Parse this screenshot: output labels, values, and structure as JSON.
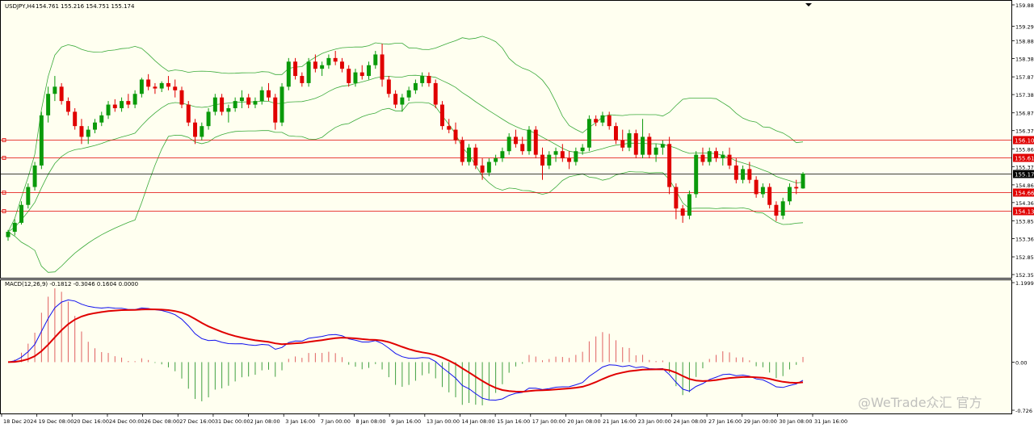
{
  "colors": {
    "background": "#fffff0",
    "frame": "#000000",
    "bull_candle": "#0a9a0a",
    "bear_candle": "#e00000",
    "bollinger": "#3aaa3a",
    "level_line": "#e00000",
    "current_price_line": "#000000",
    "macd_line": "#1010ee",
    "signal_line": "#e00000",
    "hist_positive": "#e06060",
    "hist_negative": "#40a040"
  },
  "chart": {
    "symbol_label": "USDJPY,H4",
    "ohlc_label": "154.761 155.216 154.751 155.174",
    "current_price": 155.174,
    "current_price_label": "155.174",
    "price_range": [
      152.355,
      159.885
    ],
    "price_ticks": [
      "159.885",
      "159.290",
      "158.880",
      "158.385",
      "157.875",
      "157.380",
      "156.870",
      "156.375",
      "155.865",
      "155.370",
      "154.860",
      "154.365",
      "153.855",
      "153.360",
      "152.850",
      "152.355"
    ],
    "levels": [
      {
        "value": 156.109,
        "label": "156.109"
      },
      {
        "value": 155.613,
        "label": "155.613"
      },
      {
        "value": 154.662,
        "label": "154.662"
      },
      {
        "value": 154.131,
        "label": "154.131"
      }
    ],
    "time_labels": [
      "18 Dec 2024",
      "19 Dec 08:00",
      "20 Dec 16:00",
      "24 Dec 00:00",
      "26 Dec 08:00",
      "27 Dec 16:00",
      "31 Dec 00:00",
      "2 Jan 08:00",
      "3 Jan 16:00",
      "7 Jan 00:00",
      "8 Jan 08:00",
      "9 Jan 16:00",
      "13 Jan 00:00",
      "14 Jan 08:00",
      "15 Jan 16:00",
      "17 Jan 00:00",
      "20 Jan 08:00",
      "21 Jan 16:00",
      "23 Jan 00:00",
      "24 Jan 08:00",
      "27 Jan 16:00",
      "29 Jan 00:00",
      "30 Jan 08:00",
      "31 Jan 16:00"
    ],
    "watermark": "@WeTrade众汇 官方",
    "top_marker_icon": "triangle-down-icon"
  },
  "macd": {
    "label": "MACD(12,26,9) -0.1812 -0.3046 0.1604 0.0000",
    "range": [
      -0.726,
      1.1999
    ],
    "ticks": [
      "1.1999",
      "0.00",
      "-0.726"
    ]
  },
  "chart_data": {
    "type": "candlestick",
    "title": "USDJPY,H4",
    "ylim": [
      152.355,
      159.885
    ],
    "series": [
      {
        "name": "USDJPY H4",
        "ohlc": [
          [
            153.4,
            153.6,
            153.3,
            153.55
          ],
          [
            153.55,
            153.9,
            153.45,
            153.8
          ],
          [
            153.8,
            154.4,
            153.75,
            154.3
          ],
          [
            154.3,
            154.9,
            154.2,
            154.8
          ],
          [
            154.8,
            155.5,
            154.7,
            155.4
          ],
          [
            155.4,
            156.9,
            155.3,
            156.8
          ],
          [
            156.8,
            157.6,
            156.6,
            157.4
          ],
          [
            157.4,
            157.9,
            157.2,
            157.6
          ],
          [
            157.6,
            157.7,
            157.1,
            157.2
          ],
          [
            157.2,
            157.3,
            156.8,
            156.9
          ],
          [
            156.9,
            157.0,
            156.4,
            156.5
          ],
          [
            156.5,
            156.7,
            156.0,
            156.2
          ],
          [
            156.2,
            156.5,
            156.0,
            156.4
          ],
          [
            156.4,
            156.7,
            156.3,
            156.6
          ],
          [
            156.6,
            156.9,
            156.5,
            156.8
          ],
          [
            156.8,
            157.2,
            156.7,
            157.1
          ],
          [
            157.1,
            157.25,
            156.9,
            157.0
          ],
          [
            157.0,
            157.3,
            156.9,
            157.2
          ],
          [
            157.2,
            157.4,
            157.0,
            157.1
          ],
          [
            157.1,
            157.5,
            157.0,
            157.4
          ],
          [
            157.4,
            157.85,
            157.3,
            157.8
          ],
          [
            157.8,
            157.95,
            157.5,
            157.6
          ],
          [
            157.6,
            157.7,
            157.4,
            157.55
          ],
          [
            157.55,
            157.75,
            157.45,
            157.7
          ],
          [
            157.7,
            157.9,
            157.5,
            157.6
          ],
          [
            157.6,
            157.8,
            157.3,
            157.5
          ],
          [
            157.5,
            157.6,
            157.0,
            157.1
          ],
          [
            157.1,
            157.2,
            156.5,
            156.6
          ],
          [
            156.6,
            156.7,
            156.0,
            156.2
          ],
          [
            156.2,
            156.6,
            156.1,
            156.5
          ],
          [
            156.5,
            157.0,
            156.4,
            156.9
          ],
          [
            156.9,
            157.4,
            156.8,
            157.3
          ],
          [
            157.3,
            157.4,
            156.8,
            156.9
          ],
          [
            156.9,
            157.1,
            156.6,
            157.0
          ],
          [
            157.0,
            157.3,
            156.9,
            157.2
          ],
          [
            157.2,
            157.5,
            157.0,
            157.3
          ],
          [
            157.3,
            157.4,
            157.0,
            157.1
          ],
          [
            157.1,
            157.3,
            157.0,
            157.2
          ],
          [
            157.2,
            157.6,
            157.1,
            157.5
          ],
          [
            157.5,
            157.7,
            157.2,
            157.3
          ],
          [
            157.3,
            157.4,
            156.4,
            156.6
          ],
          [
            156.6,
            157.7,
            156.5,
            157.6
          ],
          [
            157.6,
            158.4,
            157.5,
            158.3
          ],
          [
            158.3,
            158.4,
            157.8,
            157.9
          ],
          [
            157.9,
            158.0,
            157.6,
            157.7
          ],
          [
            157.7,
            158.4,
            157.6,
            158.3
          ],
          [
            158.3,
            158.5,
            158.0,
            158.1
          ],
          [
            158.1,
            158.3,
            157.9,
            158.2
          ],
          [
            158.2,
            158.5,
            158.1,
            158.4
          ],
          [
            158.4,
            158.6,
            158.2,
            158.3
          ],
          [
            158.3,
            158.4,
            158.0,
            158.1
          ],
          [
            158.1,
            158.2,
            157.6,
            157.7
          ],
          [
            157.7,
            158.1,
            157.6,
            158.0
          ],
          [
            158.0,
            158.2,
            157.8,
            157.9
          ],
          [
            157.9,
            158.3,
            157.8,
            158.2
          ],
          [
            158.2,
            158.6,
            158.1,
            158.5
          ],
          [
            158.5,
            158.8,
            157.6,
            157.8
          ],
          [
            157.8,
            157.9,
            157.3,
            157.4
          ],
          [
            157.4,
            157.5,
            157.0,
            157.1
          ],
          [
            157.1,
            157.4,
            156.9,
            157.3
          ],
          [
            157.3,
            157.6,
            157.2,
            157.5
          ],
          [
            157.5,
            157.8,
            157.4,
            157.7
          ],
          [
            157.7,
            158.0,
            157.6,
            157.9
          ],
          [
            157.9,
            158.0,
            157.6,
            157.7
          ],
          [
            157.7,
            157.8,
            157.0,
            157.1
          ],
          [
            157.1,
            157.2,
            156.4,
            156.5
          ],
          [
            156.5,
            156.7,
            156.3,
            156.4
          ],
          [
            156.4,
            156.6,
            156.0,
            156.1
          ],
          [
            156.1,
            156.2,
            155.4,
            155.5
          ],
          [
            155.5,
            156.0,
            155.4,
            155.9
          ],
          [
            155.9,
            156.0,
            155.3,
            155.4
          ],
          [
            155.4,
            155.6,
            155.0,
            155.2
          ],
          [
            155.2,
            155.6,
            155.1,
            155.5
          ],
          [
            155.5,
            155.7,
            155.4,
            155.6
          ],
          [
            155.6,
            155.9,
            155.5,
            155.8
          ],
          [
            155.8,
            156.3,
            155.7,
            156.2
          ],
          [
            156.2,
            156.4,
            155.9,
            156.0
          ],
          [
            156.0,
            156.2,
            155.7,
            155.8
          ],
          [
            155.8,
            156.5,
            155.7,
            156.4
          ],
          [
            156.4,
            156.5,
            155.6,
            155.7
          ],
          [
            155.7,
            155.9,
            155.0,
            155.4
          ],
          [
            155.4,
            155.8,
            155.3,
            155.7
          ],
          [
            155.7,
            155.9,
            155.5,
            155.8
          ],
          [
            155.8,
            156.0,
            155.5,
            155.6
          ],
          [
            155.6,
            155.8,
            155.3,
            155.5
          ],
          [
            155.5,
            155.9,
            155.4,
            155.8
          ],
          [
            155.8,
            156.0,
            155.7,
            155.9
          ],
          [
            155.9,
            156.8,
            155.8,
            156.7
          ],
          [
            156.7,
            156.8,
            156.5,
            156.6
          ],
          [
            156.6,
            156.9,
            156.5,
            156.8
          ],
          [
            156.8,
            156.9,
            156.4,
            156.5
          ],
          [
            156.5,
            156.6,
            156.0,
            156.1
          ],
          [
            156.1,
            156.4,
            155.8,
            155.9
          ],
          [
            155.9,
            156.4,
            155.8,
            156.3
          ],
          [
            156.3,
            156.4,
            155.6,
            155.7
          ],
          [
            155.7,
            156.7,
            155.6,
            156.2
          ],
          [
            156.2,
            156.3,
            155.6,
            155.7
          ],
          [
            155.7,
            156.0,
            155.5,
            155.9
          ],
          [
            155.9,
            156.1,
            155.7,
            156.0
          ],
          [
            156.0,
            156.2,
            154.6,
            154.8
          ],
          [
            154.8,
            154.9,
            153.9,
            154.2
          ],
          [
            154.2,
            154.3,
            153.8,
            154.0
          ],
          [
            154.0,
            154.7,
            153.9,
            154.6
          ],
          [
            154.6,
            155.8,
            154.5,
            155.7
          ],
          [
            155.7,
            155.9,
            155.4,
            155.5
          ],
          [
            155.5,
            155.9,
            155.4,
            155.8
          ],
          [
            155.8,
            155.9,
            155.5,
            155.6
          ],
          [
            155.6,
            155.8,
            155.4,
            155.7
          ],
          [
            155.7,
            155.9,
            155.3,
            155.4
          ],
          [
            155.4,
            155.6,
            154.9,
            155.0
          ],
          [
            155.0,
            155.4,
            154.9,
            155.3
          ],
          [
            155.3,
            155.5,
            154.9,
            155.0
          ],
          [
            155.0,
            155.1,
            154.5,
            154.6
          ],
          [
            154.6,
            154.9,
            154.5,
            154.8
          ],
          [
            154.8,
            154.9,
            154.2,
            154.3
          ],
          [
            154.3,
            154.4,
            153.85,
            154.0
          ],
          [
            154.0,
            154.5,
            153.9,
            154.4
          ],
          [
            154.4,
            154.9,
            154.3,
            154.8
          ],
          [
            154.8,
            155.0,
            154.6,
            154.76
          ],
          [
            154.76,
            155.216,
            154.751,
            155.174
          ]
        ]
      }
    ]
  }
}
